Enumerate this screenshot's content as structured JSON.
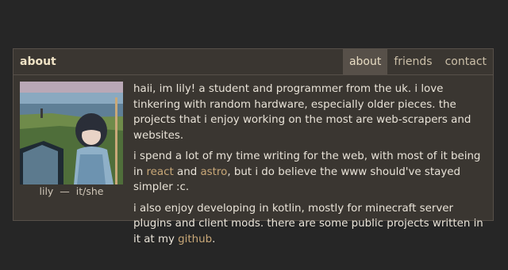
{
  "header": {
    "title": "about",
    "tabs": [
      {
        "label": "about",
        "active": true
      },
      {
        "label": "friends",
        "active": false
      },
      {
        "label": "contact",
        "active": false
      }
    ]
  },
  "profile": {
    "name": "lily",
    "separator": "—",
    "pronouns": "it/she"
  },
  "paragraphs": {
    "p1": "haii, im lily! a student and programmer from the uk. i love tinkering with random hardware, especially older pieces. the projects that i enjoy working on the most are web-scrapers and websites.",
    "p2_before": "i spend a lot of my time writing for the web, with most of it being in ",
    "p2_link1": "react",
    "p2_mid": " and ",
    "p2_link2": "astro",
    "p2_after": ", but i do believe the www should've stayed simpler :c.",
    "p3_before": "i also enjoy developing in kotlin, mostly for minecraft server plugins and client mods. there are some public projects written in it at my ",
    "p3_link": "github",
    "p3_after": "."
  },
  "colors": {
    "background": "#262626",
    "card": "#3a3631",
    "border": "#575049",
    "accent_link": "#c9a878",
    "title": "#f0e3c6"
  }
}
